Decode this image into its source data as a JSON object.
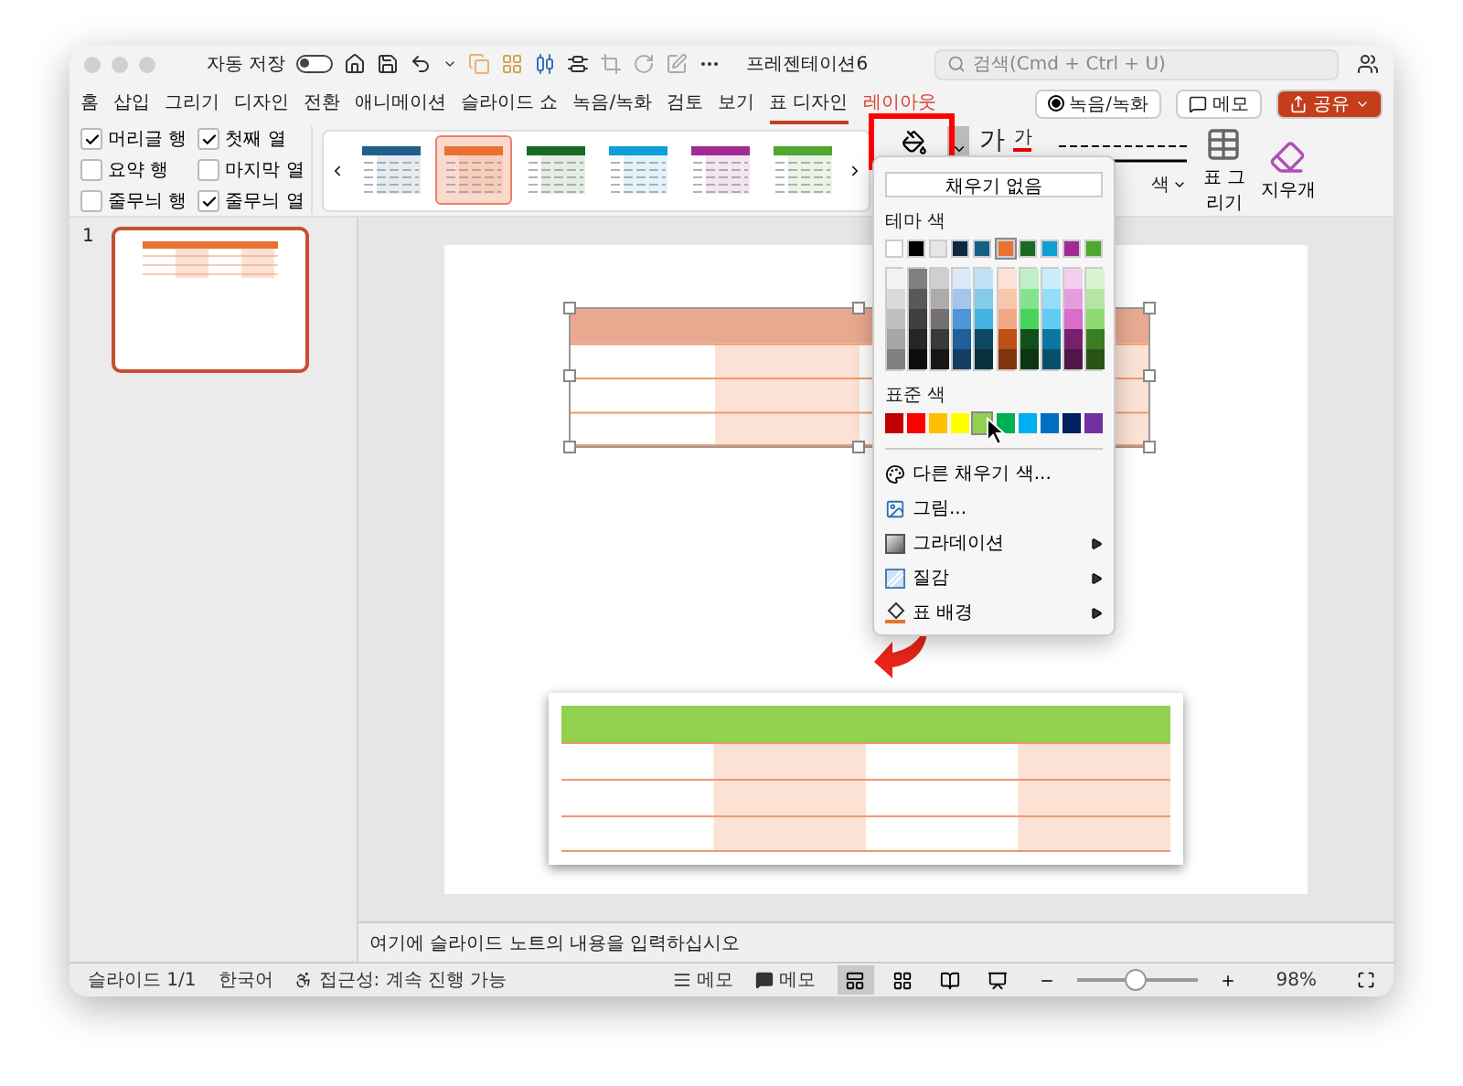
{
  "window": {
    "title": "프레젠테이션6",
    "autosave_label": "자동 저장",
    "autosave_on": false
  },
  "search": {
    "placeholder": "검색(Cmd + Ctrl + U)"
  },
  "tabs": [
    {
      "label": "홈",
      "kind": "standard",
      "selected": false
    },
    {
      "label": "삽입",
      "kind": "standard",
      "selected": false
    },
    {
      "label": "그리기",
      "kind": "standard",
      "selected": false
    },
    {
      "label": "디자인",
      "kind": "standard",
      "selected": false
    },
    {
      "label": "전환",
      "kind": "standard",
      "selected": false
    },
    {
      "label": "애니메이션",
      "kind": "standard",
      "selected": false
    },
    {
      "label": "슬라이드 쇼",
      "kind": "standard",
      "selected": false
    },
    {
      "label": "녹음/녹화",
      "kind": "standard",
      "selected": false
    },
    {
      "label": "검토",
      "kind": "standard",
      "selected": false
    },
    {
      "label": "보기",
      "kind": "standard",
      "selected": false
    },
    {
      "label": "표 디자인",
      "kind": "contextual",
      "selected": true
    },
    {
      "label": "레이아웃",
      "kind": "contextual",
      "selected": false
    }
  ],
  "header_buttons": {
    "record": "녹음/녹화",
    "comments": "메모",
    "share": "공유"
  },
  "table_style_options": [
    {
      "label": "머리글 행",
      "checked": true
    },
    {
      "label": "첫째 열",
      "checked": true
    },
    {
      "label": "요약 행",
      "checked": false
    },
    {
      "label": "마지막 열",
      "checked": false
    },
    {
      "label": "줄무늬 행",
      "checked": false
    },
    {
      "label": "줄무늬 열",
      "checked": true
    }
  ],
  "table_styles": [
    {
      "color": "#1f5f8b",
      "selected": false
    },
    {
      "color": "#e97132",
      "selected": true
    },
    {
      "color": "#196b24",
      "selected": false
    },
    {
      "color": "#0f9ed5",
      "selected": false
    },
    {
      "color": "#a02b93",
      "selected": false
    },
    {
      "color": "#4ea72e",
      "selected": false
    }
  ],
  "ribbon": {
    "text_effect": "가",
    "font_color": "가",
    "pen_color": "색",
    "draw_table": "표 그리기",
    "eraser": "지우개"
  },
  "slides": [
    {
      "number": "1",
      "selected": true
    }
  ],
  "slide": {
    "tables": [
      {
        "color": "#e8a990",
        "selected": true
      },
      {
        "color": "#92d050",
        "selected": false
      }
    ]
  },
  "fill_menu": {
    "no_fill": "채우기 없음",
    "theme_heading": "테마 색",
    "theme_colors": [
      {
        "color": "#ffffff",
        "selected": false
      },
      {
        "color": "#000000",
        "selected": false
      },
      {
        "color": "#e7e6e6",
        "selected": false
      },
      {
        "color": "#0e2841",
        "selected": false
      },
      {
        "color": "#156082",
        "selected": false
      },
      {
        "color": "#e97132",
        "selected": true
      },
      {
        "color": "#196b24",
        "selected": false
      },
      {
        "color": "#0f9ed5",
        "selected": false
      },
      {
        "color": "#a02b93",
        "selected": false
      },
      {
        "color": "#4ea72e",
        "selected": false
      }
    ],
    "shades": [
      {
        "swatches": [
          {
            "color": "#f2f2f2"
          },
          {
            "color": "#d9d9d9"
          },
          {
            "color": "#bfbfbf"
          },
          {
            "color": "#a6a6a6"
          },
          {
            "color": "#808080"
          }
        ]
      },
      {
        "swatches": [
          {
            "color": "#7f7f7f"
          },
          {
            "color": "#595959"
          },
          {
            "color": "#404040"
          },
          {
            "color": "#262626"
          },
          {
            "color": "#0d0d0d"
          }
        ]
      },
      {
        "swatches": [
          {
            "color": "#d0cece"
          },
          {
            "color": "#aeabab"
          },
          {
            "color": "#757171"
          },
          {
            "color": "#3b3838"
          },
          {
            "color": "#171616"
          }
        ]
      },
      {
        "swatches": [
          {
            "color": "#dceaf7"
          },
          {
            "color": "#a5c5ea"
          },
          {
            "color": "#4e95d9"
          },
          {
            "color": "#215f9a"
          },
          {
            "color": "#153d63"
          }
        ]
      },
      {
        "swatches": [
          {
            "color": "#c0e4f5"
          },
          {
            "color": "#83caeb"
          },
          {
            "color": "#44b3e1"
          },
          {
            "color": "#0f4761"
          },
          {
            "color": "#0b3040"
          }
        ]
      },
      {
        "swatches": [
          {
            "color": "#fbe2d5"
          },
          {
            "color": "#f7c7ac"
          },
          {
            "color": "#f1a983"
          },
          {
            "color": "#c04f15"
          },
          {
            "color": "#80350e"
          }
        ]
      },
      {
        "swatches": [
          {
            "color": "#c1f0c8"
          },
          {
            "color": "#84e291"
          },
          {
            "color": "#47d45a"
          },
          {
            "color": "#124f1a"
          },
          {
            "color": "#0c3512"
          }
        ]
      },
      {
        "swatches": [
          {
            "color": "#caeefb"
          },
          {
            "color": "#95dcf7"
          },
          {
            "color": "#61cbf3"
          },
          {
            "color": "#0b76a0"
          },
          {
            "color": "#074f6a"
          }
        ]
      },
      {
        "swatches": [
          {
            "color": "#f2cfee"
          },
          {
            "color": "#e59edd"
          },
          {
            "color": "#d86dcb"
          },
          {
            "color": "#77206d"
          },
          {
            "color": "#501549"
          }
        ]
      },
      {
        "swatches": [
          {
            "color": "#d9f2d0"
          },
          {
            "color": "#b4e5a2"
          },
          {
            "color": "#8ed973"
          },
          {
            "color": "#3a7d22"
          },
          {
            "color": "#275317"
          }
        ]
      }
    ],
    "standard_heading": "표준 색",
    "standard_colors": [
      {
        "color": "#c00000",
        "selected": false
      },
      {
        "color": "#ff0000",
        "selected": false
      },
      {
        "color": "#ffc000",
        "selected": false
      },
      {
        "color": "#ffff00",
        "selected": false
      },
      {
        "color": "#92d050",
        "selected": true
      },
      {
        "color": "#00b050",
        "selected": false
      },
      {
        "color": "#00b0f0",
        "selected": false
      },
      {
        "color": "#0070c0",
        "selected": false
      },
      {
        "color": "#002060",
        "selected": false
      },
      {
        "color": "#7030a0",
        "selected": false
      }
    ],
    "items": [
      {
        "label": "다른 채우기 색...",
        "kind": "palette",
        "submenu": false
      },
      {
        "label": "그림...",
        "kind": "picture",
        "submenu": false
      },
      {
        "label": "그라데이션",
        "kind": "gradient",
        "submenu": true
      },
      {
        "label": "질감",
        "kind": "texture",
        "submenu": true
      },
      {
        "label": "표 배경",
        "kind": "background",
        "submenu": true
      }
    ]
  },
  "notes": {
    "placeholder": "여기에 슬라이드 노트의 내용을 입력하십시오"
  },
  "status_bar": {
    "slide": "슬라이드 1/1",
    "language": "한국어",
    "accessibility": "접근성: 계속 진행 가능",
    "notes": "메모",
    "comments": "메모",
    "views": [
      {
        "kind": "normal",
        "selected": true
      },
      {
        "kind": "sorter",
        "selected": false
      },
      {
        "kind": "reading",
        "selected": false
      },
      {
        "kind": "show",
        "selected": false
      }
    ],
    "zoom": {
      "level": 0.49,
      "reading": "98%"
    }
  }
}
